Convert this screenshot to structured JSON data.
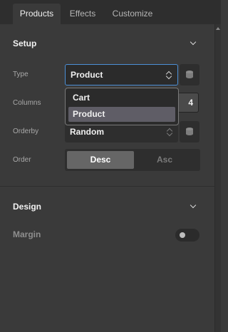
{
  "tabs": [
    "Products",
    "Effects",
    "Customize"
  ],
  "setup": {
    "title": "Setup",
    "type_label": "Type",
    "type_value": "Product",
    "columns_label": "Columns",
    "columns_value": "4",
    "orderby_label": "Orderby",
    "orderby_value": "Random",
    "order_label": "Order",
    "order_options": [
      "Desc",
      "Asc"
    ],
    "order_selected": "Desc"
  },
  "type_dropdown": {
    "options": [
      "Cart",
      "Product"
    ],
    "selected": "Product"
  },
  "design": {
    "title": "Design",
    "margin_label": "Margin",
    "margin_enabled": false
  },
  "colors": {
    "panel": "#3a3a3a",
    "focus": "#4b8fd6"
  }
}
